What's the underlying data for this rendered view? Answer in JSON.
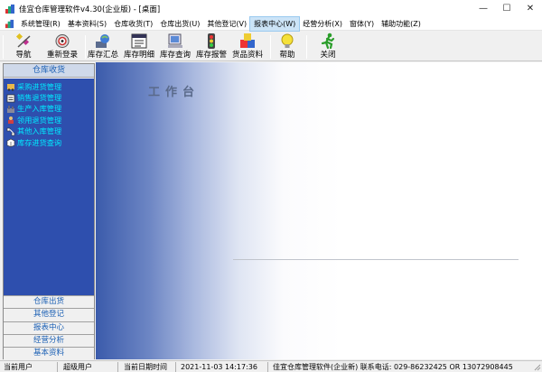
{
  "window": {
    "title": "佳宜仓库管理软件v4.30(企业版)  - [桌面]",
    "controls": [
      "—",
      "☐",
      "✕"
    ]
  },
  "menubar": {
    "items": [
      {
        "label": "系统管理(R)",
        "active": false
      },
      {
        "label": "基本资料(S)",
        "active": false
      },
      {
        "label": "仓库收货(T)",
        "active": false
      },
      {
        "label": "仓库出货(U)",
        "active": false
      },
      {
        "label": "其他登记(V)",
        "active": false
      },
      {
        "label": "报表中心(W)",
        "active": true
      },
      {
        "label": "经营分析(X)",
        "active": false
      },
      {
        "label": "窗体(Y)",
        "active": false
      },
      {
        "label": "辅助功能(Z)",
        "active": false
      }
    ]
  },
  "toolbar": {
    "buttons": [
      {
        "label": "导航",
        "icon": "navigation-icon"
      },
      {
        "label": "重新登录",
        "icon": "relogin-icon"
      },
      {
        "label": "库存汇总",
        "icon": "inventory-summary-icon"
      },
      {
        "label": "库存明细",
        "icon": "inventory-detail-icon"
      },
      {
        "label": "库存查询",
        "icon": "inventory-query-icon"
      },
      {
        "label": "库存报警",
        "icon": "traffic-light-icon"
      },
      {
        "label": "货品资料",
        "icon": "goods-info-icon"
      },
      {
        "label": "帮助",
        "icon": "lightbulb-icon"
      },
      {
        "label": "关闭",
        "icon": "running-man-icon"
      }
    ]
  },
  "leftpanel": {
    "active_group": "仓库收货",
    "tasks": [
      {
        "label": "采购进货管理",
        "icon": "purchase-icon"
      },
      {
        "label": "销售退货管理",
        "icon": "sales-return-icon"
      },
      {
        "label": "生产入库管理",
        "icon": "production-icon"
      },
      {
        "label": "领用退货管理",
        "icon": "requisition-return-icon"
      },
      {
        "label": "其他入库管理",
        "icon": "other-inbound-icon"
      },
      {
        "label": "库存进货查询",
        "icon": "stock-query-icon"
      }
    ],
    "groups": [
      "仓库出货",
      "其他登记",
      "报表中心",
      "经营分析",
      "基本资料"
    ]
  },
  "main": {
    "title": "工作台"
  },
  "statusbar": {
    "current_user_label": "当前用户",
    "current_user_value": "超级用户",
    "current_date_label": "当前日期时间",
    "current_date_value": "2021-11-03 14:17:36",
    "company_info": "佳宜仓库管理软件(企业新) 联系电话: 029-86232425 OR 13072908445"
  },
  "colors": {
    "panel_blue": "#2e4fae",
    "task_text": "#00eaff",
    "group_text": "#1a5fb4",
    "menu_active": "#cce4f7"
  }
}
